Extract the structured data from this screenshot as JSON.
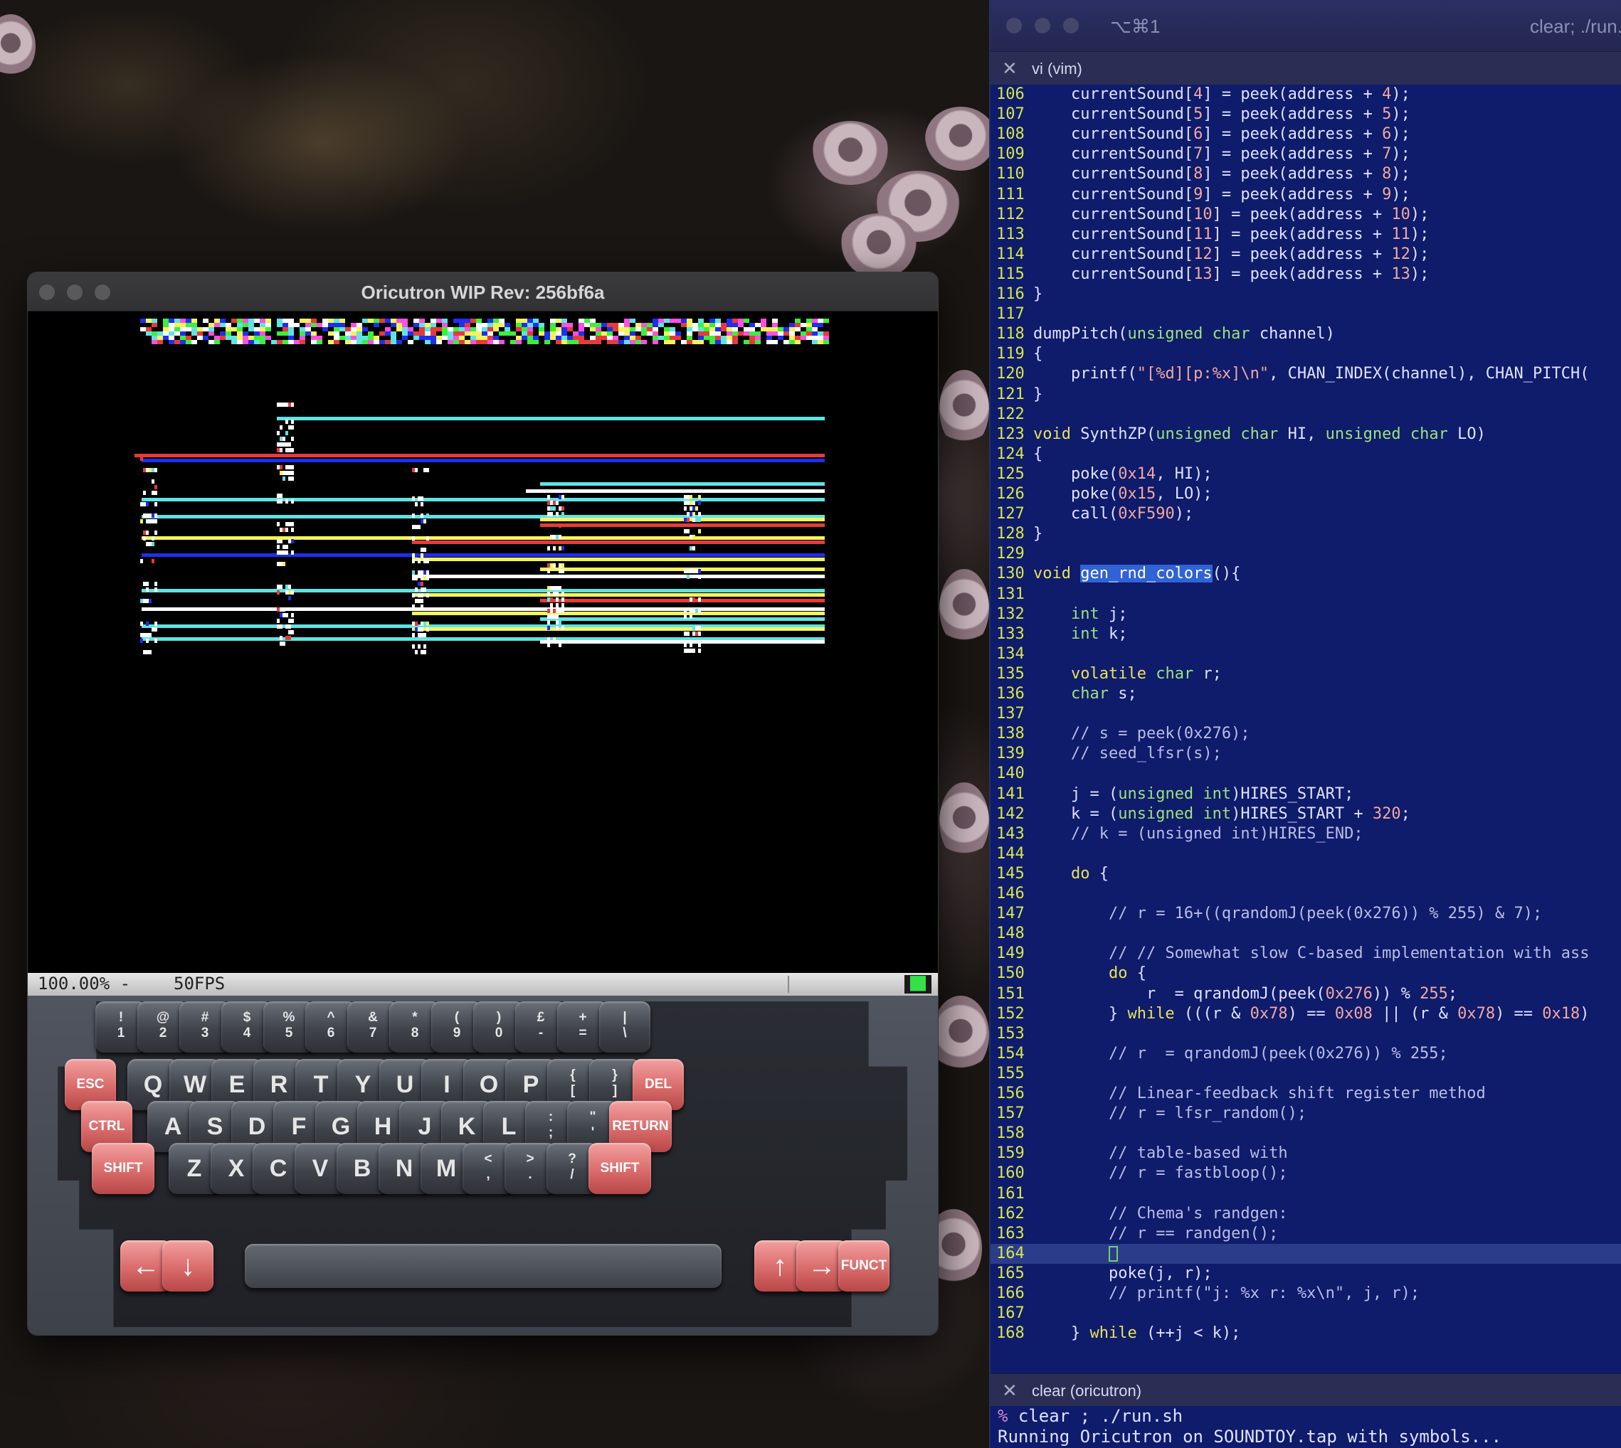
{
  "emulator": {
    "title": "Oricutron WIP Rev: 256bf6a",
    "status_zoom": "100.00% -",
    "status_fps": "50FPS",
    "status_indicator": "██",
    "keyboard": {
      "row1": [
        {
          "top": "!",
          "bottom": "1"
        },
        {
          "top": "@",
          "bottom": "2"
        },
        {
          "top": "#",
          "bottom": "3"
        },
        {
          "top": "$",
          "bottom": "4"
        },
        {
          "top": "%",
          "bottom": "5"
        },
        {
          "top": "^",
          "bottom": "6"
        },
        {
          "top": "&",
          "bottom": "7"
        },
        {
          "top": "*",
          "bottom": "8"
        },
        {
          "top": "(",
          "bottom": "9"
        },
        {
          "top": ")",
          "bottom": "0"
        },
        {
          "top": "£",
          "bottom": "-"
        },
        {
          "top": "+",
          "bottom": "="
        },
        {
          "top": "|",
          "bottom": "\\"
        }
      ],
      "row2_left": "ESC",
      "row2": [
        "Q",
        "W",
        "E",
        "R",
        "T",
        "Y",
        "U",
        "I",
        "O",
        "P"
      ],
      "row2_symbols": [
        {
          "top": "{",
          "bottom": "["
        },
        {
          "top": "}",
          "bottom": "]"
        }
      ],
      "row2_right": "DEL",
      "row3_left": "CTRL",
      "row3": [
        "A",
        "S",
        "D",
        "F",
        "G",
        "H",
        "J",
        "K",
        "L"
      ],
      "row3_symbols": [
        {
          "top": ":",
          "bottom": ";"
        },
        {
          "top": "\"",
          "bottom": "'"
        }
      ],
      "row3_right": "RETURN",
      "row4_left": "SHIFT",
      "row4": [
        "Z",
        "X",
        "C",
        "V",
        "B",
        "N",
        "M"
      ],
      "row4_symbols": [
        {
          "top": "<",
          "bottom": ","
        },
        {
          "top": ">",
          "bottom": "."
        },
        {
          "top": "?",
          "bottom": "/"
        }
      ],
      "row4_right": "SHIFT",
      "row5_left_arrow": "←",
      "row5_down_arrow": "↓",
      "row5_up_arrow": "↑",
      "row5_right_arrow": "→",
      "row5_funct": "FUNCT"
    }
  },
  "terminal": {
    "shortcut": "⌥⌘1",
    "window_title": "clear; ./run.",
    "editor_tab": "vi (vim)",
    "shell_tab": "clear (oricutron)",
    "shell_lines": [
      "% clear ; ./run.sh",
      "Running Oricutron on SOUNDTOY.tap with symbols..."
    ],
    "code": [
      {
        "n": "106",
        "t": "    currentSound[4] = peek(address + 4);"
      },
      {
        "n": "107",
        "t": "    currentSound[5] = peek(address + 5);"
      },
      {
        "n": "108",
        "t": "    currentSound[6] = peek(address + 6);"
      },
      {
        "n": "109",
        "t": "    currentSound[7] = peek(address + 7);"
      },
      {
        "n": "110",
        "t": "    currentSound[8] = peek(address + 8);"
      },
      {
        "n": "111",
        "t": "    currentSound[9] = peek(address + 9);"
      },
      {
        "n": "112",
        "t": "    currentSound[10] = peek(address + 10);"
      },
      {
        "n": "113",
        "t": "    currentSound[11] = peek(address + 11);"
      },
      {
        "n": "114",
        "t": "    currentSound[12] = peek(address + 12);"
      },
      {
        "n": "115",
        "t": "    currentSound[13] = peek(address + 13);"
      },
      {
        "n": "116",
        "t": "}"
      },
      {
        "n": "117",
        "t": ""
      },
      {
        "n": "118",
        "t": "dumpPitch(unsigned char channel)"
      },
      {
        "n": "119",
        "t": "{"
      },
      {
        "n": "120",
        "t": "    printf(\"[%d][p:%x]\\n\", CHAN_INDEX(channel), CHAN_PITCH("
      },
      {
        "n": "121",
        "t": "}"
      },
      {
        "n": "122",
        "t": ""
      },
      {
        "n": "123",
        "t": "void SynthZP(unsigned char HI, unsigned char LO)"
      },
      {
        "n": "124",
        "t": "{"
      },
      {
        "n": "125",
        "t": "    poke(0x14, HI);"
      },
      {
        "n": "126",
        "t": "    poke(0x15, LO);"
      },
      {
        "n": "127",
        "t": "    call(0xF590);"
      },
      {
        "n": "128",
        "t": "}"
      },
      {
        "n": "129",
        "t": ""
      },
      {
        "n": "130",
        "t": "void gen_rnd_colors(){"
      },
      {
        "n": "131",
        "t": ""
      },
      {
        "n": "132",
        "t": "    int j;"
      },
      {
        "n": "133",
        "t": "    int k;"
      },
      {
        "n": "134",
        "t": ""
      },
      {
        "n": "135",
        "t": "    volatile char r;"
      },
      {
        "n": "136",
        "t": "    char s;"
      },
      {
        "n": "137",
        "t": ""
      },
      {
        "n": "138",
        "t": "    // s = peek(0x276);"
      },
      {
        "n": "139",
        "t": "    // seed_lfsr(s);"
      },
      {
        "n": "140",
        "t": ""
      },
      {
        "n": "141",
        "t": "    j = (unsigned int)HIRES_START;"
      },
      {
        "n": "142",
        "t": "    k = (unsigned int)HIRES_START + 320;"
      },
      {
        "n": "143",
        "t": "    // k = (unsigned int)HIRES_END;"
      },
      {
        "n": "144",
        "t": ""
      },
      {
        "n": "145",
        "t": "    do {"
      },
      {
        "n": "146",
        "t": ""
      },
      {
        "n": "147",
        "t": "        // r = 16+((qrandomJ(peek(0x276)) % 255) & 7);"
      },
      {
        "n": "148",
        "t": ""
      },
      {
        "n": "149",
        "t": "        // // Somewhat slow C-based implementation with ass"
      },
      {
        "n": "150",
        "t": "        do {"
      },
      {
        "n": "151",
        "t": "            r  = qrandomJ(peek(0x276)) % 255;"
      },
      {
        "n": "152",
        "t": "        } while (((r & 0x78) == 0x08 || (r & 0x78) == 0x18)"
      },
      {
        "n": "153",
        "t": ""
      },
      {
        "n": "154",
        "t": "        // r  = qrandomJ(peek(0x276)) % 255;"
      },
      {
        "n": "155",
        "t": ""
      },
      {
        "n": "156",
        "t": "        // Linear-feedback shift register method"
      },
      {
        "n": "157",
        "t": "        // r = lfsr_random();"
      },
      {
        "n": "158",
        "t": ""
      },
      {
        "n": "159",
        "t": "        // table-based with"
      },
      {
        "n": "160",
        "t": "        // r = fastbloop();"
      },
      {
        "n": "161",
        "t": ""
      },
      {
        "n": "162",
        "t": "        // Chema's randgen:"
      },
      {
        "n": "163",
        "t": "        // r == randgen();"
      },
      {
        "n": "164",
        "t": "        "
      },
      {
        "n": "165",
        "t": "        poke(j, r);"
      },
      {
        "n": "166",
        "t": "        // printf(\"j: %x r: %x\\n\", j, r);"
      },
      {
        "n": "167",
        "t": ""
      },
      {
        "n": "168",
        "t": "    } while (++j < k);"
      }
    ],
    "highlight_word": "gen_rnd_colors",
    "cursor_line": "164"
  },
  "colors": {
    "terminal_bg": "#0f1b6b",
    "line_number": "#d7e64a",
    "keyword": "#e8e259",
    "type": "#9ee27a",
    "number": "#f1a9a0",
    "oric_cyan": "#5fe3e3",
    "oric_yellow": "#f4f45a",
    "oric_blue": "#1f2ef0",
    "oric_red": "#e83a3a",
    "oric_white": "#ffffff"
  }
}
